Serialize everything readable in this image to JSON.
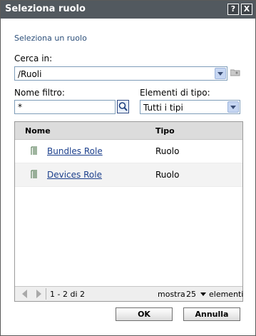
{
  "dialog": {
    "title": "Seleziona ruolo",
    "help_label": "?",
    "close_label": "X",
    "subtitle": "Seleziona un ruolo"
  },
  "look_in": {
    "label": "Cerca in:",
    "value": "/Ruoli"
  },
  "filter": {
    "label": "Nome filtro:",
    "value": "*"
  },
  "type_filter": {
    "label": "Elementi di tipo:",
    "value": "Tutti i tipi"
  },
  "grid": {
    "columns": [
      "Nome",
      "Tipo"
    ],
    "rows": [
      {
        "name": "Bundles Role",
        "type": "Ruolo"
      },
      {
        "name": "Devices Role",
        "type": "Ruolo"
      }
    ],
    "range": "1 - 2 di 2",
    "show_label": "mostra",
    "page_size": "25",
    "items_label": "elementi"
  },
  "buttons": {
    "ok": "OK",
    "cancel": "Annulla"
  },
  "colors": {
    "titlebar": "#52595f",
    "link": "#1b3f8c",
    "subtitle": "#2c4f7a"
  }
}
